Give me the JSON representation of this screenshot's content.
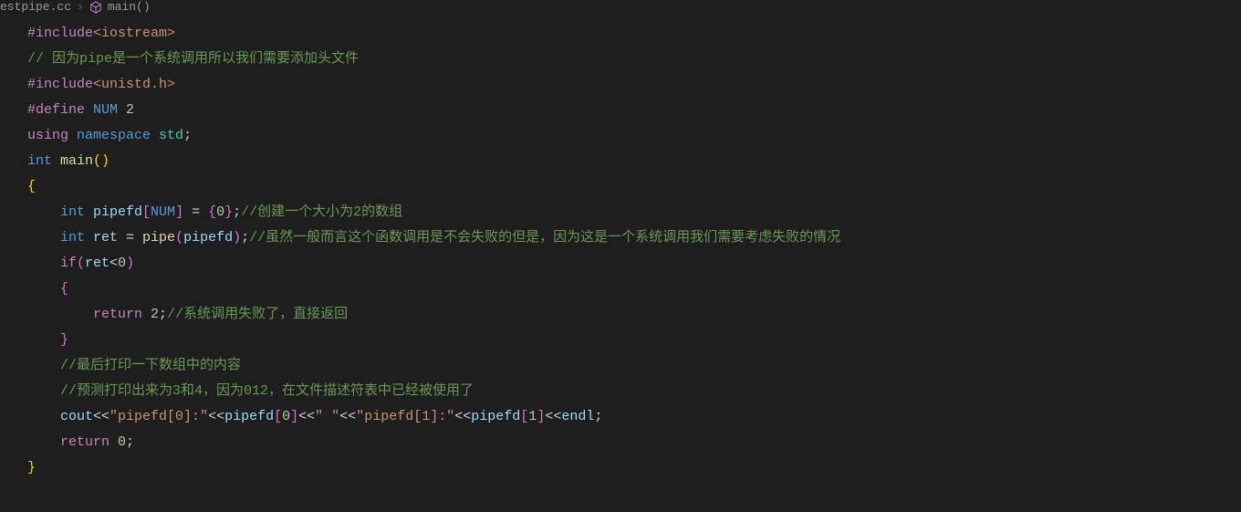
{
  "breadcrumb": {
    "file": "estpipe.cc",
    "symbol": "main()"
  },
  "code": {
    "include1_pre": "#include",
    "include1_lib": "<iostream>",
    "comment1": "// 因为pipe是一个系统调用所以我们需要添加头文件",
    "include2_pre": "#include",
    "include2_lib": "<unistd.h>",
    "define_pre": "#define",
    "define_name": " NUM ",
    "define_val": "2",
    "using": "using",
    "namespace": " namespace ",
    "std": "std",
    "semi": ";",
    "int_t": "int",
    "main_fn": " main",
    "paren_open": "(",
    "paren_close": ")",
    "brace_open": "{",
    "brace_close": "}",
    "pipefd_decl_int": "    int",
    "pipefd_var": " pipefd",
    "pipefd_bracket_o": "[",
    "pipefd_num": "NUM",
    "pipefd_bracket_c": "]",
    "pipefd_eq": " = ",
    "pipefd_init_o": "{",
    "pipefd_zero": "0",
    "pipefd_init_c": "}",
    "pipefd_comment": "//创建一个大小为2的数组",
    "ret_int": "    int",
    "ret_var": " ret",
    "ret_eq": " = ",
    "pipe_fn": "pipe",
    "pipe_arg": "pipefd",
    "ret_comment": "//虽然一般而言这个函数调用是不会失败的但是，因为这是一个系统调用我们需要考虑失败的情况",
    "if_kw": "    if",
    "if_cond_ret": "ret",
    "if_cond_op": "<",
    "if_cond_zero": "0",
    "return2_kw": "        return",
    "return2_val": " 2",
    "return2_comment": "//系统调用失败了，直接返回",
    "comment_print": "    //最后打印一下数组中的内容",
    "comment_predict": "    //预测打印出来为3和4，因为012，在文件描述符表中已经被使用了",
    "cout_indent": "    ",
    "cout": "cout",
    "lshift": "<<",
    "str_pipefd0": "\"pipefd[0]:\"",
    "pipefd_arr": "pipefd",
    "bracket_o": "[",
    "idx0": "0",
    "bracket_c": "]",
    "str_space": "\" \"",
    "str_pipefd1": "\"pipefd[1]:\"",
    "idx1": "1",
    "endl": "endl",
    "return0_kw": "    return",
    "return0_val": " 0"
  }
}
